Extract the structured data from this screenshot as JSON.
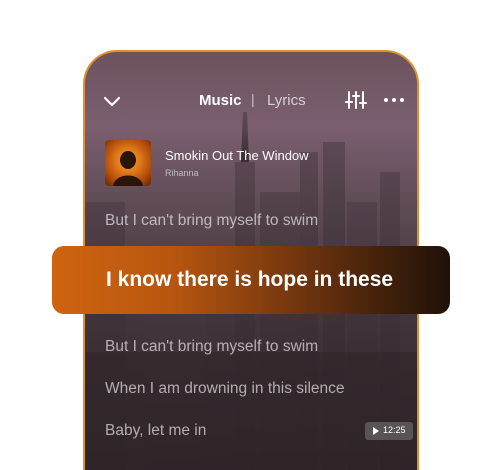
{
  "header": {
    "tab_music": "Music",
    "separator": "|",
    "tab_lyrics": "Lyrics"
  },
  "song": {
    "title": "Smokin Out The Window",
    "artist": "Rihanna"
  },
  "lyrics": {
    "line1": "But I can't bring myself to swim",
    "current": "I know there is hope in these",
    "line3": "But I can't bring myself to swim",
    "line4": "When I am drowning in this silence",
    "line5": "Baby, let me in"
  },
  "timestamp": "12:25",
  "colors": {
    "accent": "#e0902a",
    "highlight_start": "#cf6410",
    "highlight_end": "#1e1108"
  },
  "icons": [
    "chevron-down-icon",
    "equalizer-icon",
    "more-icon",
    "play-icon"
  ]
}
